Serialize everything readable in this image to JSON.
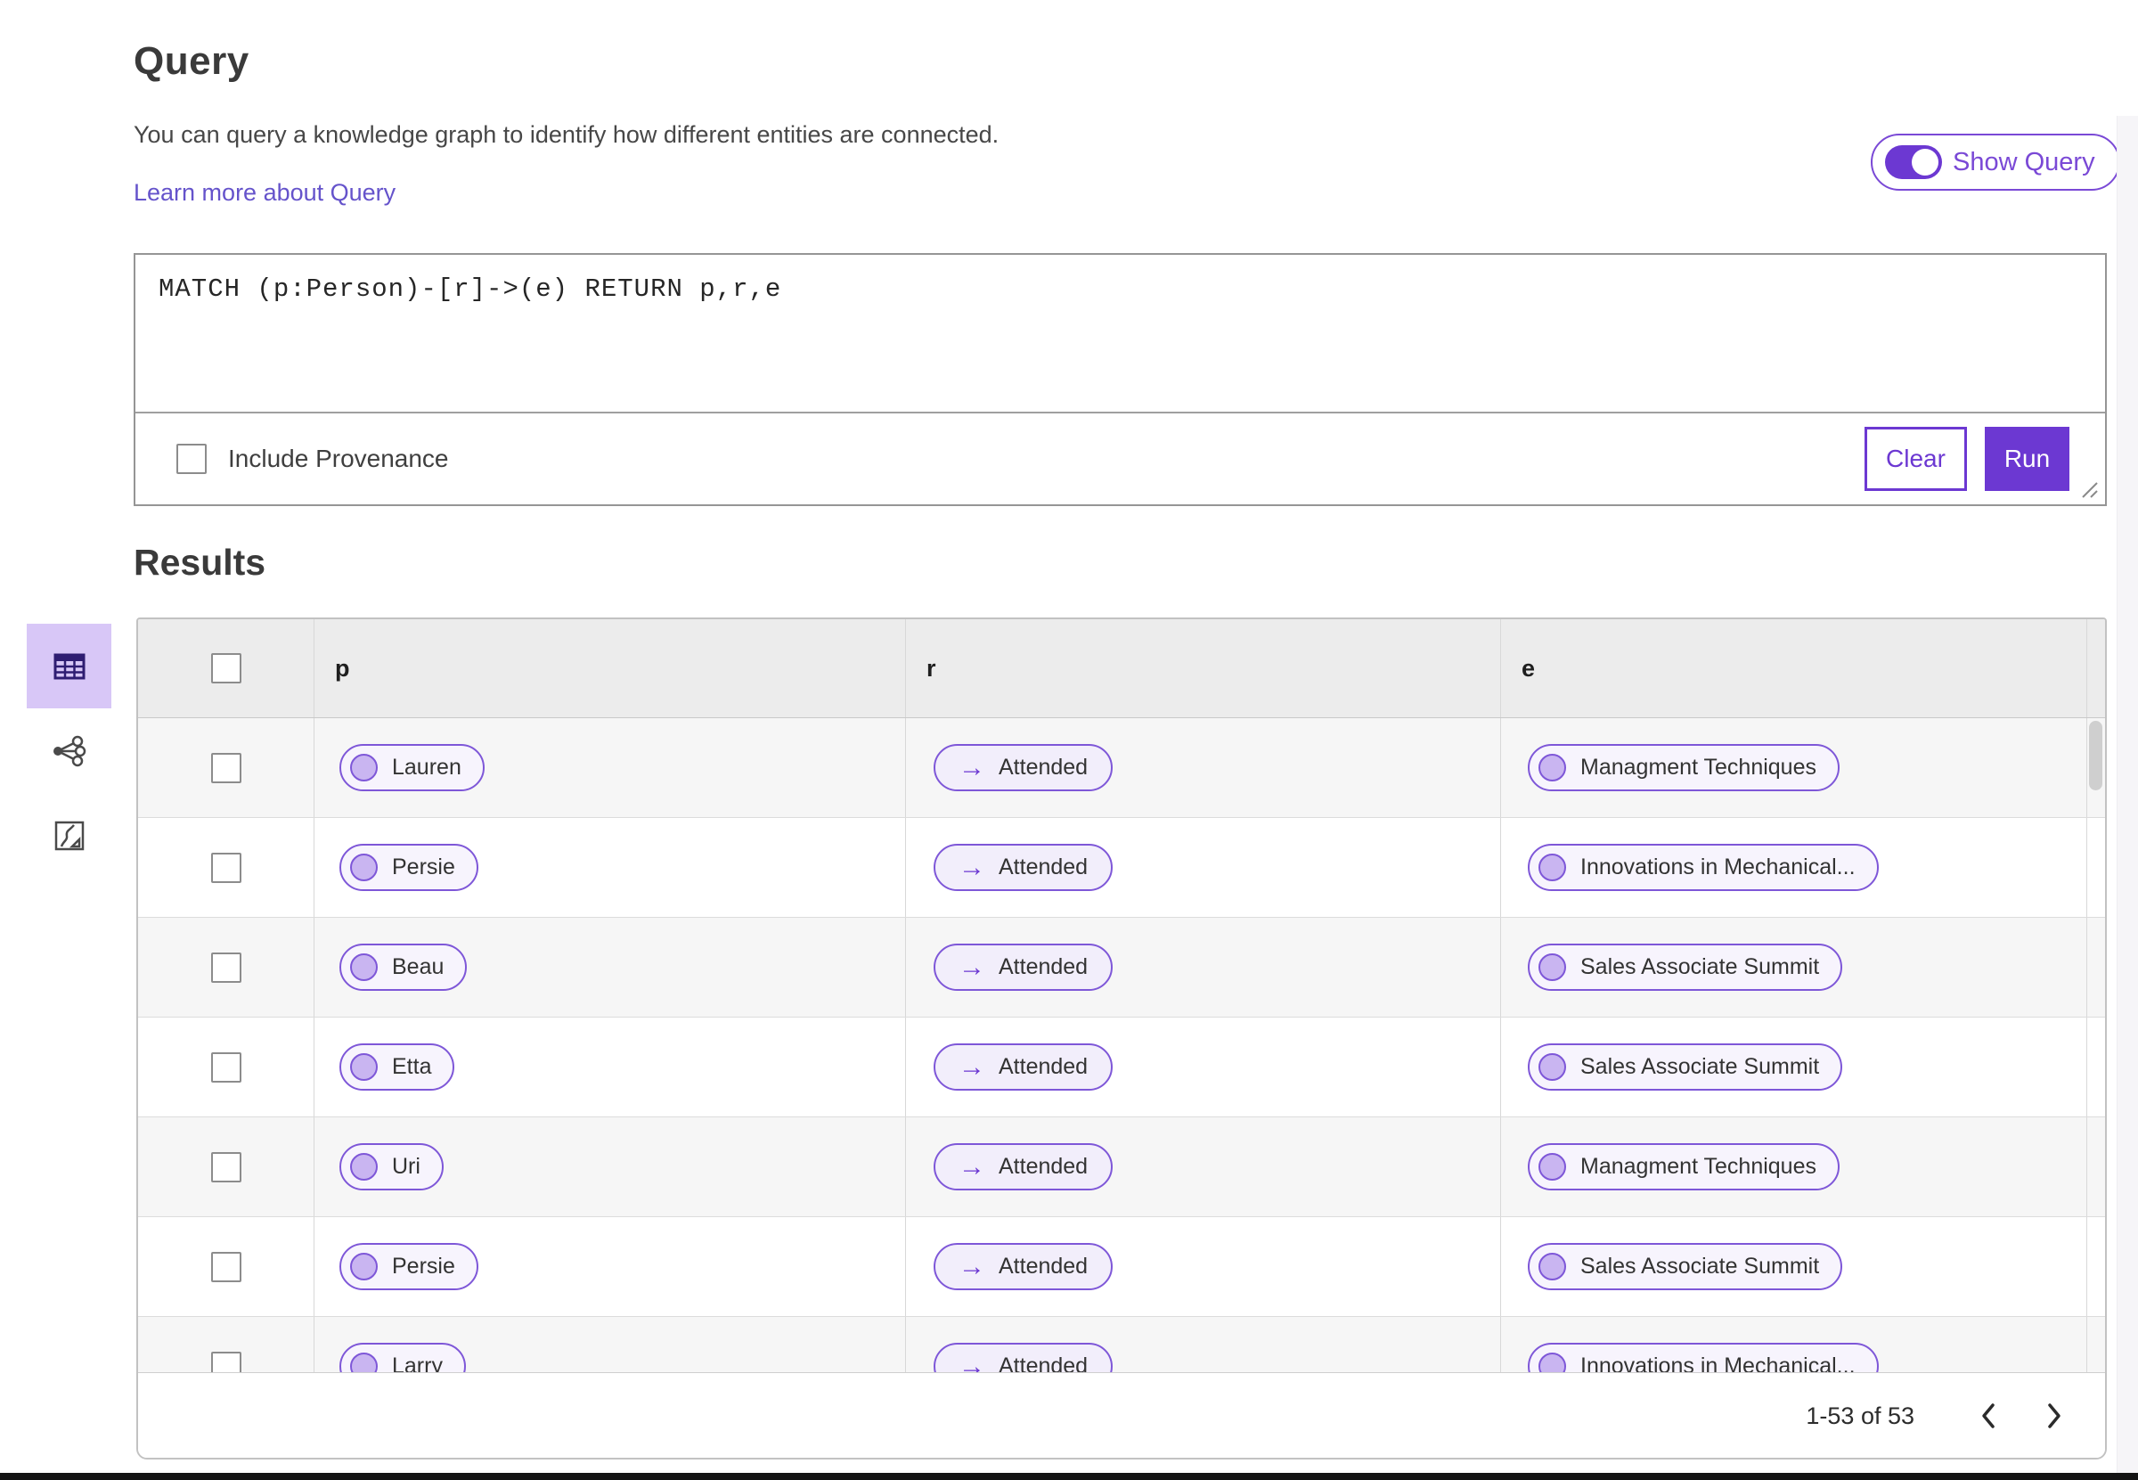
{
  "query": {
    "title": "Query",
    "description": "You can query a knowledge graph to identify how different entities are connected.",
    "learn_more_link": "Learn more about Query",
    "show_query_label": "Show Query",
    "show_query_on": true,
    "code": "MATCH (p:Person)-[r]->(e) RETURN p,r,e",
    "include_provenance_label": "Include Provenance",
    "include_provenance_checked": false,
    "clear_button": "Clear",
    "run_button": "Run"
  },
  "results": {
    "title": "Results",
    "views": [
      "table-view",
      "graph-view",
      "map-view"
    ],
    "selected_view": "table-view",
    "columns": [
      "p",
      "r",
      "e"
    ],
    "relation_arrow": "→",
    "rows": [
      {
        "p": "Lauren",
        "r": "Attended",
        "e": "Managment Techniques"
      },
      {
        "p": "Persie",
        "r": "Attended",
        "e": "Innovations in Mechanical..."
      },
      {
        "p": "Beau",
        "r": "Attended",
        "e": "Sales Associate Summit"
      },
      {
        "p": "Etta",
        "r": "Attended",
        "e": "Sales Associate Summit"
      },
      {
        "p": "Uri",
        "r": "Attended",
        "e": "Managment Techniques"
      },
      {
        "p": "Persie",
        "r": "Attended",
        "e": "Sales Associate Summit"
      },
      {
        "p": "Larry",
        "r": "Attended",
        "e": "Innovations in Mechanical..."
      }
    ],
    "pagination": {
      "range_label": "1-53 of 53"
    }
  },
  "colors": {
    "accent": "#6c38d2",
    "toggle_border": "#7a49d6",
    "pill_border": "#7e57d8",
    "pill_bg": "#f7f4fd",
    "relation_pill_bg": "#f2eefb",
    "dot_fill": "#c9b5f1",
    "selected_tile_bg": "#d8c7f7",
    "link": "#6553cb",
    "header_bg": "#ececec",
    "alt_row_bg": "#f6f6f6"
  }
}
